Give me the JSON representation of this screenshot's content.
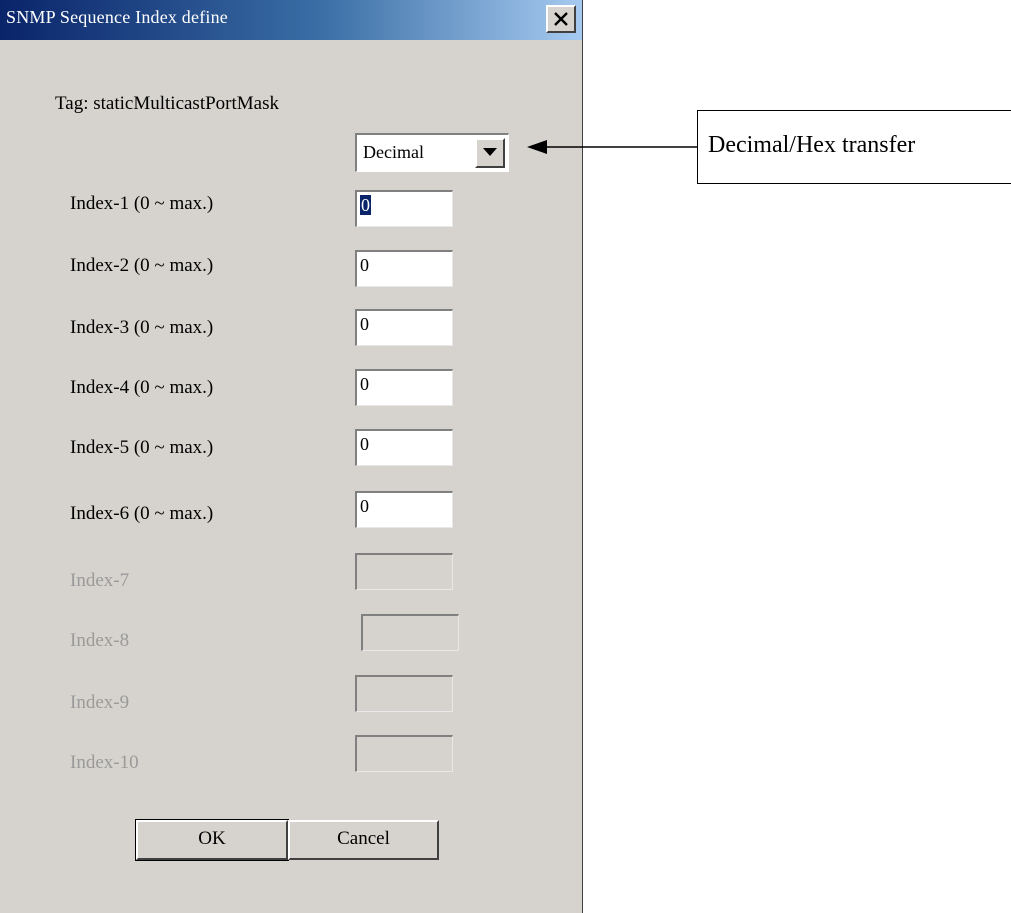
{
  "dialog": {
    "title": "SNMP Sequence Index define",
    "tag_label": "Tag: staticMulticastPortMask",
    "format": {
      "selected": "Decimal"
    },
    "indices": [
      {
        "label": "Index-1 (0 ~ max.)",
        "value": "0",
        "enabled": true,
        "focused": true
      },
      {
        "label": "Index-2 (0 ~ max.)",
        "value": "0",
        "enabled": true
      },
      {
        "label": "Index-3 (0 ~ max.)",
        "value": "0",
        "enabled": true
      },
      {
        "label": "Index-4 (0 ~ max.)",
        "value": "0",
        "enabled": true
      },
      {
        "label": "Index-5 (0 ~ max.)",
        "value": "0",
        "enabled": true
      },
      {
        "label": "Index-6 (0 ~ max.)",
        "value": "0",
        "enabled": true
      },
      {
        "label": "Index-7",
        "value": "",
        "enabled": false
      },
      {
        "label": "Index-8",
        "value": "",
        "enabled": false
      },
      {
        "label": "Index-9",
        "value": "",
        "enabled": false
      },
      {
        "label": "Index-10",
        "value": "",
        "enabled": false
      }
    ],
    "ok_label": "OK",
    "cancel_label": "Cancel"
  },
  "callout": {
    "text": "Decimal/Hex transfer"
  },
  "icons": {
    "close": "close-icon",
    "dropdown": "chevron-down-icon",
    "arrow": "arrow-left-icon"
  }
}
